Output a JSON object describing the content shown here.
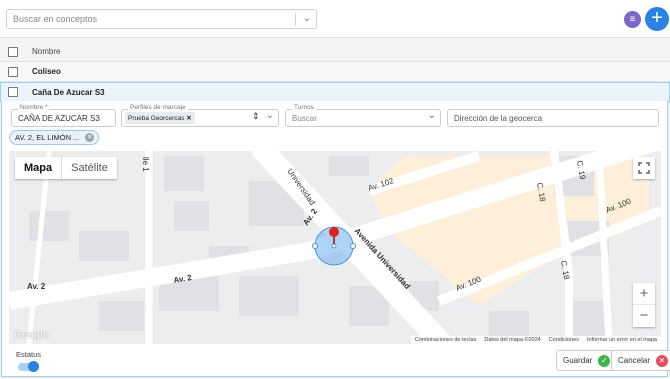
{
  "search": {
    "placeholder": "Buscar en conceptos"
  },
  "toolbar": {
    "menu_icon": "list-icon",
    "add_icon": "plus-icon"
  },
  "table": {
    "header": "Nombre",
    "rows": [
      {
        "name": "Coliseo"
      },
      {
        "name": "Caña De Azucar S3"
      }
    ]
  },
  "form": {
    "name_label": "Nombre *",
    "name_value": "CAÑA DE AZUCAR S3",
    "profiles_label": "Perfiles de marcaje",
    "profile_tag": "Prueba Georcercas",
    "shifts_label": "Turnos",
    "shifts_placeholder": "Buscar",
    "address_placeholder": "Dirección de la geocerca",
    "chip": "AV. 2, EL LIMÓN ..."
  },
  "map": {
    "type_map": "Mapa",
    "type_satellite": "Satélite",
    "streets": [
      "Universidad",
      "Av. 102",
      "Av. 2",
      "Av. 2",
      "Avenida Universidad",
      "Av. 100",
      "Av. 100",
      "C. 18",
      "C. 19",
      "C. 18",
      "lle 1"
    ],
    "attribution": [
      "Combinaciones de teclas",
      "Datos del mapa ©2024",
      "Condiciones",
      "Informar un error en el mapa"
    ],
    "logo": "Google",
    "zoom_in": "+",
    "zoom_out": "−"
  },
  "footer": {
    "status_label": "Estatus",
    "status_on": true,
    "save_label": "Guardar",
    "cancel_label": "Cancelar"
  },
  "colors": {
    "accent": "#2a82e4",
    "menu": "#7a69c9",
    "save": "#3cb54a",
    "cancel": "#e84a5f",
    "highlight": "#fdefd9"
  }
}
